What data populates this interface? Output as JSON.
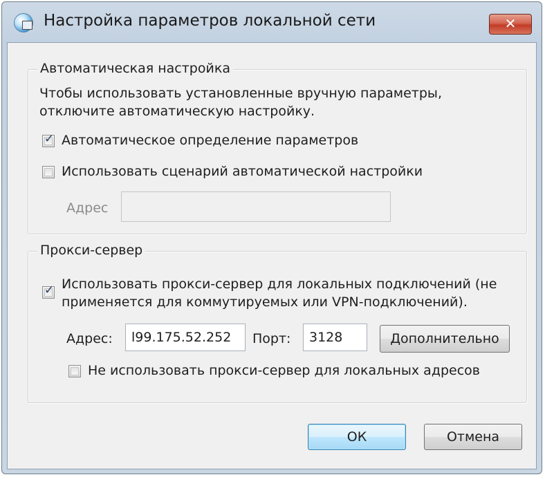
{
  "window": {
    "title": "Настройка параметров локальной сети",
    "close_label": "✕"
  },
  "auto_config": {
    "group_title": "Автоматическая настройка",
    "description_line1": "Чтобы использовать установленные вручную параметры,",
    "description_line2": "отключите автоматическую настройку.",
    "auto_detect": {
      "label": "Автоматическое определение параметров",
      "checked": true
    },
    "use_script": {
      "label": "Использовать сценарий автоматической настройки",
      "checked": false
    },
    "address_label": "Адрес",
    "address_value": ""
  },
  "proxy": {
    "group_title": "Прокси-сервер",
    "use_proxy": {
      "label_line1": "Использовать прокси-сервер для локальных подключений (не",
      "label_line2": "применяется для коммутируемых или VPN-подключений).",
      "checked": true
    },
    "address_label": "Адрес:",
    "address_value": "l99.175.52.252",
    "port_label": "Порт:",
    "port_value": "3128",
    "advanced_button": "Дополнительно",
    "bypass_local": {
      "label": "Не использовать прокси-сервер для локальных адресов",
      "checked": false
    }
  },
  "buttons": {
    "ok": "ОК",
    "cancel": "Отмена"
  },
  "icons": {
    "app": "network-settings-icon",
    "close": "close-icon",
    "check": "checkmark-icon"
  }
}
